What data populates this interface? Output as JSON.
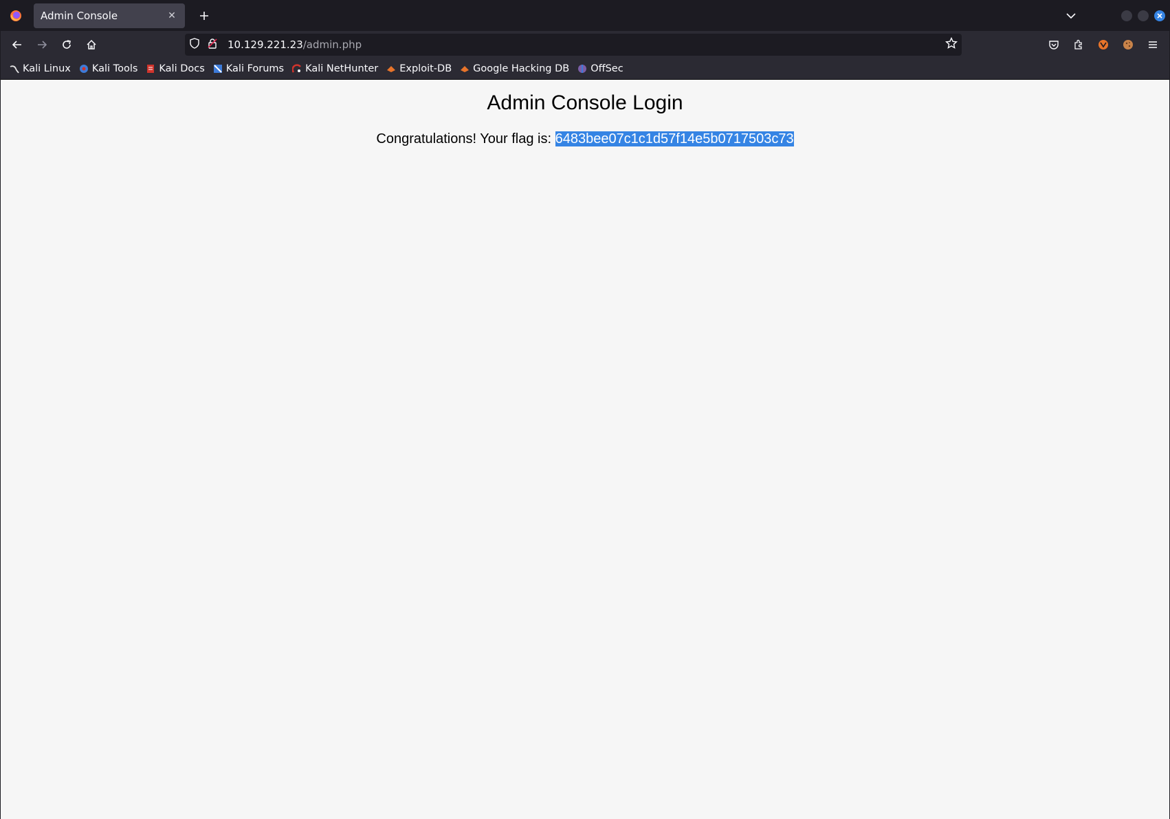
{
  "browser": {
    "tab": {
      "title": "Admin Console",
      "close_glyph": "✕"
    },
    "new_tab_glyph": "+",
    "url": {
      "host": "10.129.221.23",
      "path": "/admin.php"
    },
    "bookmarks": [
      {
        "label": "Kali Linux",
        "icon": "kali-dragon-icon",
        "color": "#1c1c1c"
      },
      {
        "label": "Kali Tools",
        "icon": "kali-tools-icon",
        "color": "#3d7bd9"
      },
      {
        "label": "Kali Docs",
        "icon": "kali-docs-icon",
        "color": "#d0342c"
      },
      {
        "label": "Kali Forums",
        "icon": "kali-forums-icon",
        "color": "#3d7bd9"
      },
      {
        "label": "Kali NetHunter",
        "icon": "nethunter-icon",
        "color": "#d0342c"
      },
      {
        "label": "Exploit-DB",
        "icon": "exploit-db-icon",
        "color": "#e8742a"
      },
      {
        "label": "Google Hacking DB",
        "icon": "ghdb-icon",
        "color": "#e8742a"
      },
      {
        "label": "OffSec",
        "icon": "offsec-icon",
        "color": "#7b5ea7"
      }
    ]
  },
  "page": {
    "heading": "Admin Console Login",
    "message_prefix": "Congratulations! Your flag is: ",
    "flag": "6483bee07c1c1d57f14e5b0717503c73"
  },
  "colors": {
    "selection": "#3584e4",
    "chrome_dark": "#1c1b22",
    "toolbar": "#2b2a33"
  }
}
